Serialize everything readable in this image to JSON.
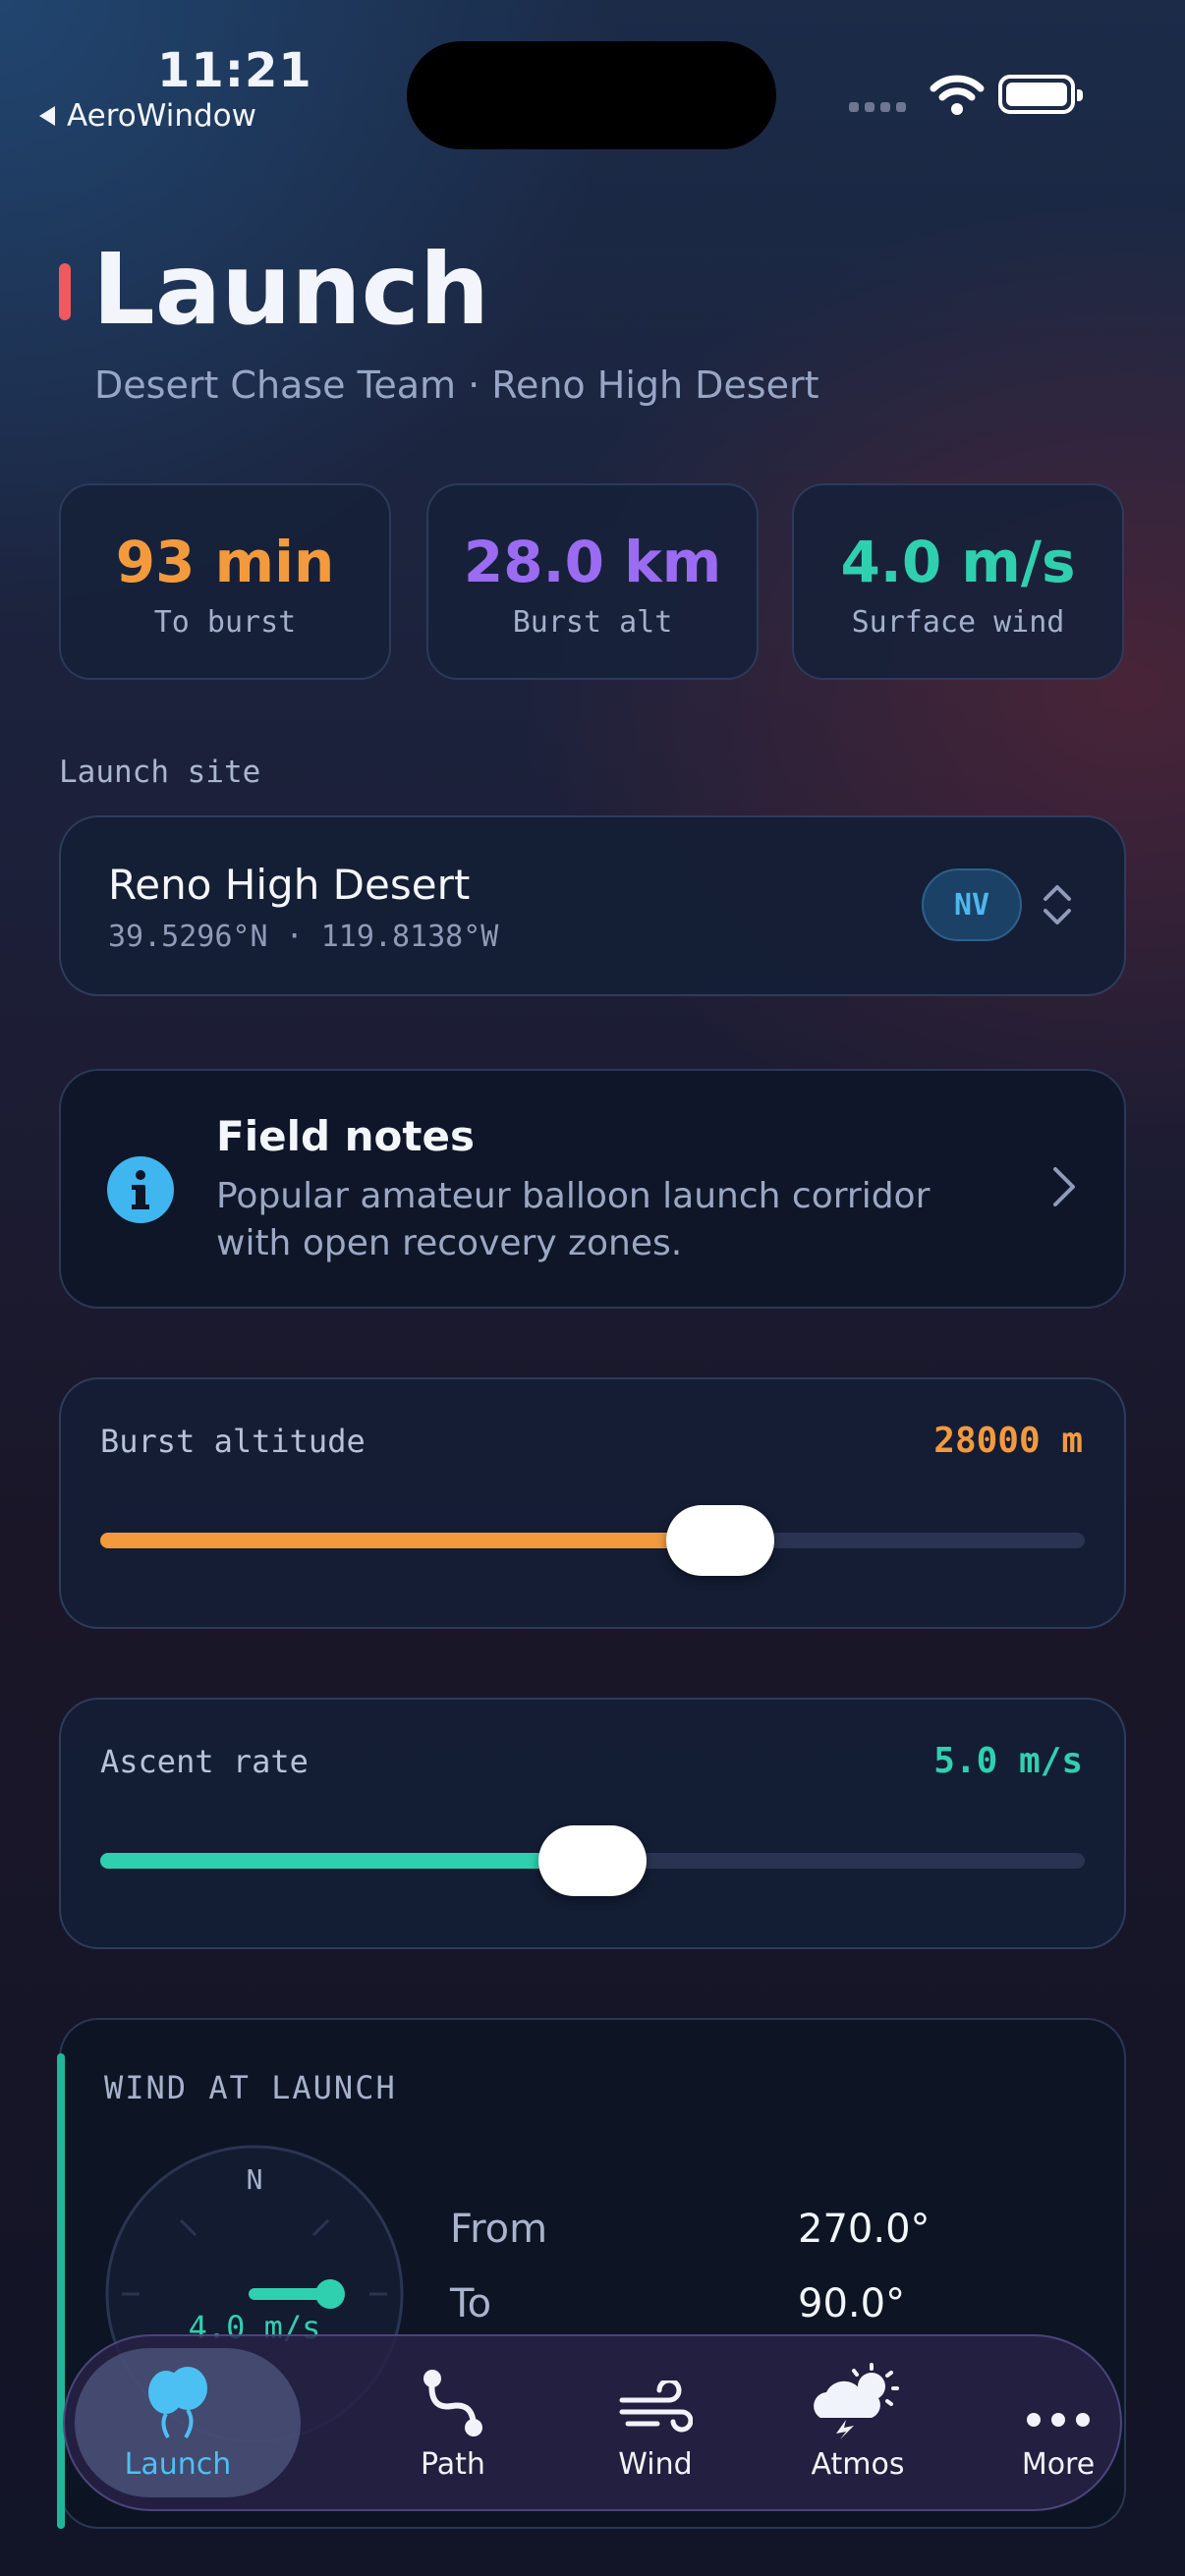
{
  "status_bar": {
    "time": "11:21",
    "back_label": "AeroWindow"
  },
  "header": {
    "title": "Launch",
    "subtitle": "Desert Chase Team · Reno High Desert"
  },
  "stats": [
    {
      "value": "93 min",
      "label": "To burst",
      "color": "#f39a3d"
    },
    {
      "value": "28.0 km",
      "label": "Burst alt",
      "color": "#9b6bf2"
    },
    {
      "value": "4.0 m/s",
      "label": "Surface wind",
      "color": "#2fd0b0"
    }
  ],
  "launch_site": {
    "section_label": "Launch site",
    "name": "Reno High Desert",
    "coords": "39.5296°N · 119.8138°W",
    "badge": "NV"
  },
  "field_notes": {
    "title": "Field notes",
    "body": "Popular amateur balloon launch corridor with open recovery zones."
  },
  "burst_altitude": {
    "label": "Burst altitude",
    "value": "28000 m",
    "fraction": 0.63,
    "color": "#f39a3d"
  },
  "ascent_rate": {
    "label": "Ascent rate",
    "value": "5.0 m/s",
    "fraction": 0.5,
    "color": "#2fd0b0"
  },
  "wind": {
    "title": "WIND AT LAUNCH",
    "compass_north": "N",
    "compass_speed": "4.0 m/s",
    "rows": [
      {
        "label": "From",
        "value": "270.0°"
      },
      {
        "label": "To",
        "value": "90.0°"
      }
    ]
  },
  "tabs": [
    {
      "label": "Launch",
      "icon": "balloons-icon",
      "active": true
    },
    {
      "label": "Path",
      "icon": "path-icon",
      "active": false
    },
    {
      "label": "Wind",
      "icon": "wind-icon",
      "active": false
    },
    {
      "label": "Atmos",
      "icon": "storm-sun-icon",
      "active": false
    },
    {
      "label": "More",
      "icon": "more-icon",
      "active": false
    }
  ]
}
